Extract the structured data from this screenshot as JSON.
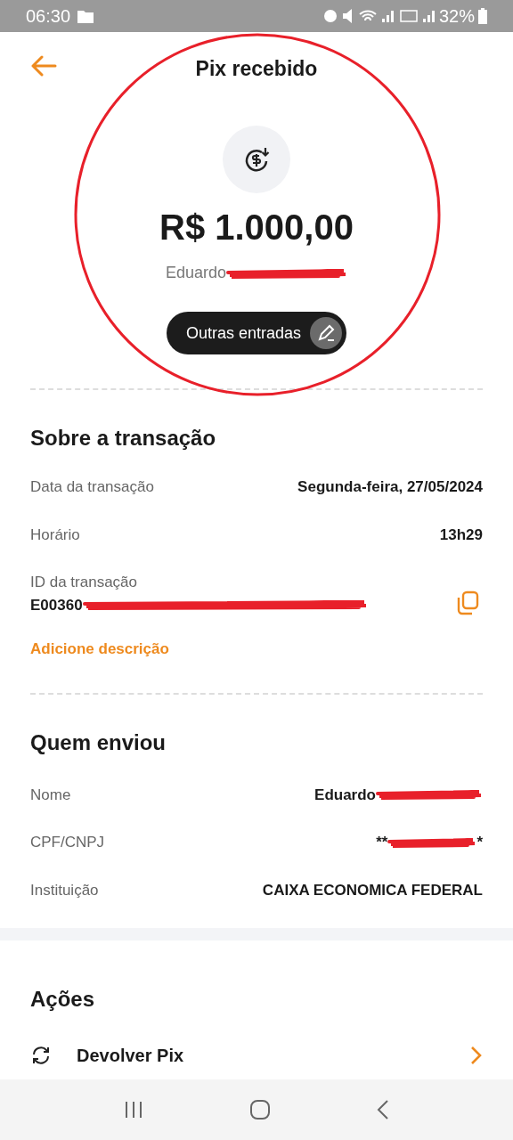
{
  "status_bar": {
    "time": "06:30",
    "battery": "32%"
  },
  "header": {
    "title": "Pix recebido"
  },
  "summary": {
    "amount": "R$ 1.000,00",
    "sender": "Eduardo",
    "category": "Outras entradas"
  },
  "transaction": {
    "title": "Sobre a transação",
    "rows": [
      {
        "label": "Data da transação",
        "value": "Segunda-feira, 27/05/2024"
      },
      {
        "label": "Horário",
        "value": "13h29"
      }
    ],
    "id_label": "ID da transação",
    "id_value": "E00360",
    "add_description": "Adicione descrição"
  },
  "sender": {
    "title": "Quem enviou",
    "rows": [
      {
        "label": "Nome",
        "value": "Eduardo",
        "value_end": ""
      },
      {
        "label": "CPF/CNPJ",
        "value": "**",
        "value_end": "*"
      },
      {
        "label": "Instituição",
        "value": "CAIXA ECONOMICA FEDERAL",
        "value_end": ""
      }
    ]
  },
  "actions": {
    "title": "Ações",
    "items": [
      {
        "label": "Devolver Pix"
      }
    ]
  }
}
